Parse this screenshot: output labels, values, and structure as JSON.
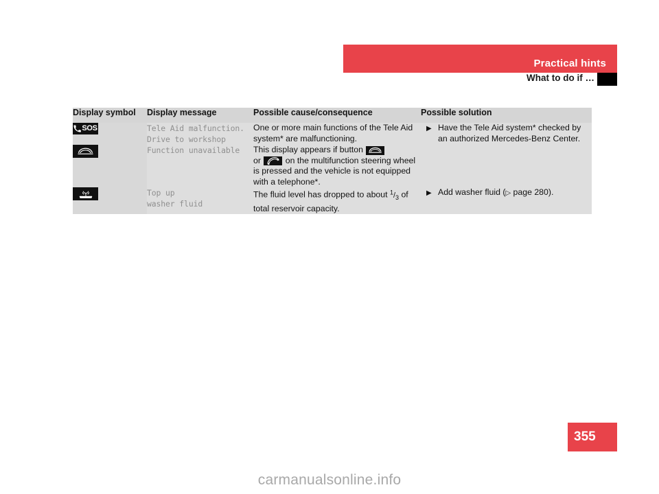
{
  "header": {
    "band_title": "Practical hints",
    "sub_title": "What to do if …",
    "band_color": "#e8434a",
    "thumb_tab_color": "#000000"
  },
  "table": {
    "columns": [
      "Display symbol",
      "Display message",
      "Possible cause/consequence",
      "Possible solution"
    ],
    "rows": [
      {
        "symbol_icon": "sos-emergency-call-icon",
        "symbol_label": "SOS",
        "message": "Tele Aid malfunction.\nDrive to workshop",
        "cause": "One or more main functions of the Tele Aid system* are malfunctioning.",
        "solution": "Have the Tele Aid system* checked by an authorized Mercedes-Benz Center.",
        "bullet": "▶"
      },
      {
        "symbol_icon": "phone-hang-up-icon",
        "symbol_label": "",
        "message": "Function unavailable",
        "cause_part1": "This display appears if button",
        "cause_icon1": "phone-hang-up-icon",
        "cause_part2": "or",
        "cause_icon2": "phone-pick-up-icon",
        "cause_part3": "on the multifunction steering wheel is pressed and the vehicle is not equipped with a telephone*.",
        "solution": "",
        "bullet": ""
      },
      {
        "symbol_icon": "washer-fluid-icon",
        "symbol_label": "",
        "message": "Top up\nwasher fluid",
        "cause_part1": "The fluid level has dropped to about",
        "cause_fraction_num": "1",
        "cause_fraction_den": "3",
        "cause_part2": "of total reservoir capacity.",
        "solution_part1": "Add washer fluid (",
        "solution_ref_arrow": "▷",
        "solution_part2": " page 280).",
        "bullet": "▶"
      }
    ]
  },
  "page_number": "355",
  "watermark": "carmanualsonline.info"
}
